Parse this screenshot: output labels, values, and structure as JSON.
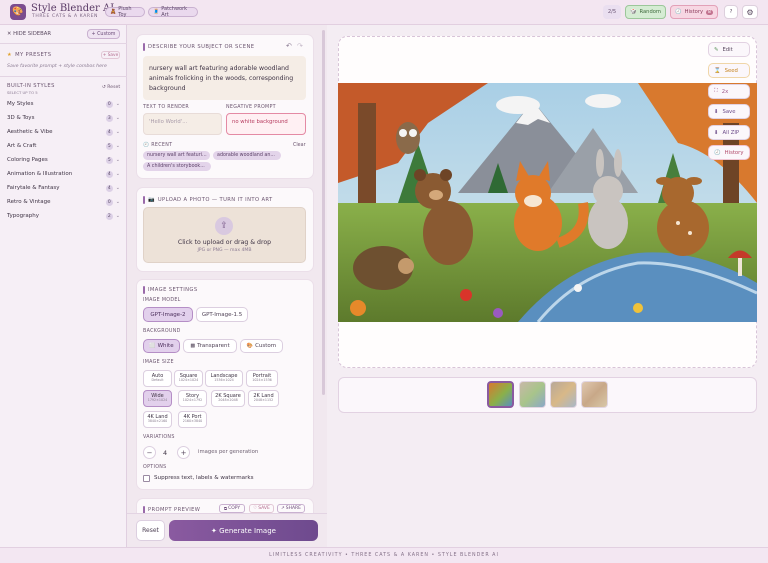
{
  "header": {
    "logo": "🎨",
    "title": "Style Blender AI",
    "subtitle": "THREE CATS & A KAREN",
    "chips": [
      {
        "icon": "🧸",
        "label": "Plush Toy"
      },
      {
        "icon": "🧵",
        "label": "Patchwork Art"
      }
    ],
    "count": "2/5",
    "random_label": "Random",
    "history_label": "History",
    "history_count": "8",
    "help": "?",
    "settings_icon": "⚙"
  },
  "sidebar": {
    "hide_label": "✕ HIDE SIDEBAR",
    "custom_label": "+ Custom",
    "presets_title": "MY PRESETS",
    "save_label": "+ Save",
    "presets_hint": "Save favorite prompt + style combos here",
    "builtin_title": "BUILT-IN STYLES",
    "builtin_sub": "SELECT UP TO 5",
    "reset_label": "↺ Reset",
    "items": [
      {
        "label": "My Styles",
        "count": "0"
      },
      {
        "label": "3D & Toys",
        "count": "3"
      },
      {
        "label": "Aesthetic & Vibe",
        "count": "4"
      },
      {
        "label": "Art & Craft",
        "count": "5"
      },
      {
        "label": "Coloring Pages",
        "count": "5"
      },
      {
        "label": "Animation & Illustration",
        "count": "4"
      },
      {
        "label": "Fairytale & Fantasy",
        "count": "4"
      },
      {
        "label": "Retro & Vintage",
        "count": "0"
      },
      {
        "label": "Typography",
        "count": "2"
      }
    ]
  },
  "describe": {
    "title": "DESCRIBE YOUR SUBJECT OR SCENE",
    "text": "nursery wall art featuring adorable woodland animals frolicking in the woods, corresponding background",
    "render_label": "TEXT TO RENDER",
    "render_placeholder": "'Hello World'...",
    "negative_label": "NEGATIVE PROMPT",
    "negative_value": "no white background",
    "recent_label": "RECENT",
    "clear_label": "Clear",
    "recent": [
      "nursery wall art featuri...",
      "adorable woodland an...",
      "A children's storybook..."
    ]
  },
  "upload": {
    "title": "UPLOAD A PHOTO — TURN IT INTO ART",
    "main": "Click to upload or drag & drop",
    "sub": "JPG or PNG — max 4MB"
  },
  "settings": {
    "title": "IMAGE SETTINGS",
    "model_label": "IMAGE MODEL",
    "models": [
      "GPT-Image-2",
      "GPT-Image-1.5"
    ],
    "bg_label": "BACKGROUND",
    "backgrounds": [
      "White",
      "Transparent",
      "Custom"
    ],
    "size_label": "IMAGE SIZE",
    "sizes": [
      {
        "name": "Auto",
        "dim": "Default"
      },
      {
        "name": "Square",
        "dim": "1024×1024"
      },
      {
        "name": "Landscape",
        "dim": "1536×1024"
      },
      {
        "name": "Portrait",
        "dim": "1024×1536"
      },
      {
        "name": "Wide",
        "dim": "1792×1024"
      },
      {
        "name": "Story",
        "dim": "1024×1792"
      },
      {
        "name": "2K Square",
        "dim": "2048×2048"
      },
      {
        "name": "2K Land",
        "dim": "2048×1152"
      },
      {
        "name": "4K Land",
        "dim": "3840×2160"
      },
      {
        "name": "4K Port",
        "dim": "2160×3840"
      }
    ],
    "variations_label": "VARIATIONS",
    "variations_value": "4",
    "variations_unit": "images per generation",
    "options_label": "OPTIONS",
    "suppress_label": "Suppress text, labels & watermarks"
  },
  "preview": {
    "title": "PROMPT PREVIEW",
    "copy": "COPY",
    "save": "SAVE",
    "share": "SHARE"
  },
  "actions": {
    "reset": "Reset",
    "generate": "✦ Generate Image"
  },
  "image_actions": [
    {
      "icon": "✎",
      "label": "Edit"
    },
    {
      "icon": "⌛",
      "label": "Seed"
    },
    {
      "icon": "⛶",
      "label": "2x"
    },
    {
      "icon": "⬇",
      "label": "Save"
    },
    {
      "icon": "⬇",
      "label": "All ZIP"
    },
    {
      "icon": "🕘",
      "label": "History"
    }
  ],
  "footer": "LIMITLESS CREATIVITY • THREE CATS & A KAREN • STYLE BLENDER AI",
  "colors": {
    "accent": "#7b4c8f",
    "generate": "#8a5aa0",
    "random": "#d5ecd3",
    "history": "#f7d7e3"
  }
}
